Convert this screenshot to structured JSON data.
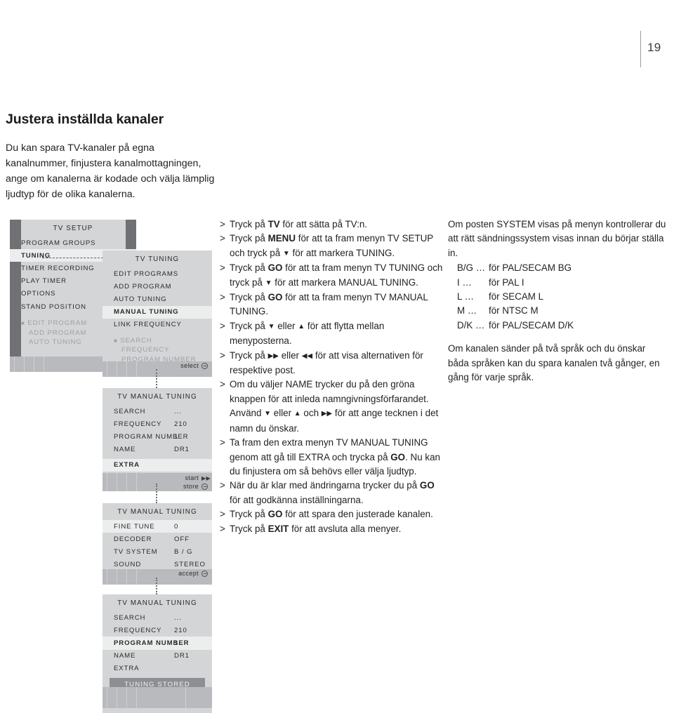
{
  "page": {
    "number": "19"
  },
  "heading": {
    "title": "Justera inställda kanaler",
    "intro": "Du kan spara TV-kanaler på egna kanalnummer, finjustera kanalmottagningen, ange om kanalerna är kodade och välja lämplig ljudtyp för de olika kanalerna."
  },
  "instructions": [
    {
      "gt": ">",
      "parts": [
        {
          "t": "Tryck på "
        },
        {
          "t": "TV",
          "b": true
        },
        {
          "t": " för att sätta på TV:n."
        }
      ]
    },
    {
      "gt": ">",
      "parts": [
        {
          "t": "Tryck på "
        },
        {
          "t": "MENU",
          "b": true
        },
        {
          "t": " för att ta fram menyn TV SETUP och tryck på "
        },
        {
          "t": "▼",
          "arrow": true
        },
        {
          "t": " för att markera TUNING."
        }
      ]
    },
    {
      "gt": ">",
      "parts": [
        {
          "t": "Tryck på "
        },
        {
          "t": "GO",
          "b": true
        },
        {
          "t": " för att ta fram menyn TV TUNING och tryck på "
        },
        {
          "t": "▼",
          "arrow": true
        },
        {
          "t": " för att markera MANUAL TUNING."
        }
      ]
    },
    {
      "gt": ">",
      "parts": [
        {
          "t": "Tryck på "
        },
        {
          "t": "GO",
          "b": true
        },
        {
          "t": " för att ta fram menyn TV MANUAL TUNING."
        }
      ]
    },
    {
      "gt": ">",
      "parts": [
        {
          "t": "Tryck på "
        },
        {
          "t": "▼",
          "arrow": true
        },
        {
          "t": " eller "
        },
        {
          "t": "▲",
          "arrow": true
        },
        {
          "t": " för att flytta mellan menyposterna."
        }
      ]
    },
    {
      "gt": ">",
      "parts": [
        {
          "t": "Tryck på "
        },
        {
          "t": "▶▶",
          "arrow": true
        },
        {
          "t": " eller "
        },
        {
          "t": "◀◀",
          "arrow": true
        },
        {
          "t": " för att visa alternativen för respektive post."
        }
      ]
    },
    {
      "gt": ">",
      "parts": [
        {
          "t": "Om du väljer NAME trycker du på den gröna knappen för att inleda namngivningsförfarandet. Använd "
        },
        {
          "t": "▼",
          "arrow": true
        },
        {
          "t": " eller "
        },
        {
          "t": "▲",
          "arrow": true
        },
        {
          "t": " och "
        },
        {
          "t": "▶▶",
          "arrow": true
        },
        {
          "t": " för att ange tecknen i det namn du önskar."
        }
      ]
    },
    {
      "gt": ">",
      "parts": [
        {
          "t": "Ta fram den extra menyn TV MANUAL TUNING genom att gå till EXTRA och trycka på "
        },
        {
          "t": "GO",
          "b": true
        },
        {
          "t": ". Nu kan du finjustera om så behövs eller välja ljudtyp."
        }
      ]
    },
    {
      "gt": ">",
      "parts": [
        {
          "t": "När du är klar med ändringarna trycker du på "
        },
        {
          "t": "GO",
          "b": true
        },
        {
          "t": " för att godkänna inställningarna."
        }
      ]
    },
    {
      "gt": ">",
      "parts": [
        {
          "t": "Tryck på "
        },
        {
          "t": "GO",
          "b": true
        },
        {
          "t": " för att spara den justerade kanalen."
        }
      ]
    },
    {
      "gt": ">",
      "parts": [
        {
          "t": "Tryck på "
        },
        {
          "t": "EXIT",
          "b": true
        },
        {
          "t": " för att avsluta alla menyer."
        }
      ]
    }
  ],
  "notes": {
    "system_intro": "Om posten SYSTEM visas på menyn kontrollerar du att rätt sändningssystem visas innan du börjar ställa in.",
    "system_rows": [
      {
        "key": "B/G …",
        "value": "för PAL/SECAM BG"
      },
      {
        "key": "I …",
        "value": "för PAL I"
      },
      {
        "key": "L …",
        "value": "för SECAM L"
      },
      {
        "key": "M …",
        "value": "för NTSC M"
      },
      {
        "key": "D/K …",
        "value": "för PAL/SECAM D/K"
      }
    ],
    "dual_language": "Om kanalen sänder på två språk och du önskar båda språken kan du spara kanalen två gånger, en gång för varje språk."
  },
  "osd": {
    "panel1": {
      "title": "TV SETUP",
      "items": [
        {
          "label": "PROGRAM GROUPS"
        },
        {
          "label": "TUNING",
          "highlighted": true
        },
        {
          "label": "TIMER RECORDING"
        },
        {
          "label": "PLAY TIMER"
        },
        {
          "label": "OPTIONS"
        },
        {
          "label": "STAND POSITION"
        }
      ],
      "sub_items": [
        "EDIT PROGRAM",
        "ADD PROGRAM",
        "AUTO TUNING"
      ],
      "footer": {
        "label": "select"
      }
    },
    "panel2": {
      "title": "TV TUNING",
      "items": [
        {
          "label": "EDIT PROGRAMS"
        },
        {
          "label": "ADD PROGRAM"
        },
        {
          "label": "AUTO TUNING"
        },
        {
          "label": "MANUAL TUNING",
          "highlighted": true
        },
        {
          "label": "LINK FREQUENCY"
        }
      ],
      "sub_items": [
        "SEARCH",
        "FREQUENCY",
        "PROGRAM NUMBER"
      ],
      "footer": {
        "label": "select"
      }
    },
    "panel3": {
      "title": "TV MANUAL TUNING",
      "rows": [
        {
          "key": "SEARCH",
          "value": "..."
        },
        {
          "key": "FREQUENCY",
          "value": "210"
        },
        {
          "key": "PROGRAM NUMBER",
          "value": "1"
        },
        {
          "key": "NAME",
          "value": "DR1"
        },
        {
          "key": "EXTRA",
          "value": "",
          "highlighted": true
        }
      ],
      "footer": {
        "label_start": "start",
        "label_store": "store"
      }
    },
    "panel4": {
      "title": "TV MANUAL TUNING",
      "rows": [
        {
          "key": "FINE TUNE",
          "value": "0",
          "highlighted": true
        },
        {
          "key": "DECODER",
          "value": "OFF"
        },
        {
          "key": "TV SYSTEM",
          "value": "B / G"
        },
        {
          "key": "SOUND",
          "value": "STEREO"
        }
      ],
      "footer": {
        "label": "accept"
      }
    },
    "panel5": {
      "title": "TV MANUAL TUNING",
      "rows": [
        {
          "key": "SEARCH",
          "value": "..."
        },
        {
          "key": "FREQUENCY",
          "value": "210"
        },
        {
          "key": "PROGRAM NUMBER",
          "value": "1",
          "highlighted": true
        },
        {
          "key": "NAME",
          "value": "DR1"
        },
        {
          "key": "EXTRA",
          "value": ""
        }
      ],
      "stored_label": "TUNING STORED"
    }
  },
  "colors": {
    "osd_bg": "#d4d5d7",
    "osd_highlight": "#eceded",
    "osd_footer": "#b9babd",
    "osd_strip": "#6f7175",
    "stored_bar": "#8d8f93",
    "text": "#231f20"
  }
}
